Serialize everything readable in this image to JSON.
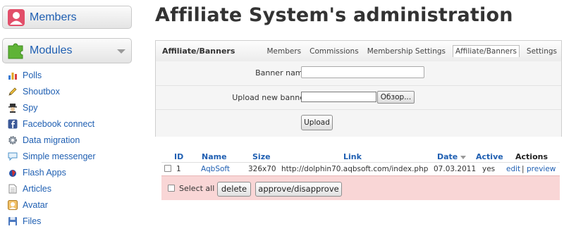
{
  "sidebar": {
    "members": {
      "label": "Members",
      "icon": "members-icon"
    },
    "modules": {
      "label": "Modules",
      "icon": "puzzle-icon"
    },
    "items": [
      {
        "label": "Polls",
        "icon": "bar-chart-icon"
      },
      {
        "label": "Shoutbox",
        "icon": "pencil-icon"
      },
      {
        "label": "Spy",
        "icon": "spy-icon"
      },
      {
        "label": "Facebook connect",
        "icon": "facebook-icon"
      },
      {
        "label": "Data migration",
        "icon": "migration-gear-icon"
      },
      {
        "label": "Simple messenger",
        "icon": "speech-bubble-icon"
      },
      {
        "label": "Flash Apps",
        "icon": "flash-icon"
      },
      {
        "label": "Articles",
        "icon": "document-icon"
      },
      {
        "label": "Avatar",
        "icon": "avatar-icon"
      },
      {
        "label": "Files",
        "icon": "floppy-icon"
      }
    ]
  },
  "page": {
    "title": "Affiliate System's administration"
  },
  "panel": {
    "title": "Affiliate/Banners",
    "tabs": [
      {
        "label": "Members",
        "active": false
      },
      {
        "label": "Commissions",
        "active": false
      },
      {
        "label": "Membership Settings",
        "active": false
      },
      {
        "label": "Affiliate/Banners",
        "active": true
      },
      {
        "label": "Settings",
        "active": false
      }
    ],
    "banner_name_label": "Banner name:",
    "banner_name_value": "",
    "upload_label": "Upload new banner:",
    "browse_label": "Обзор...",
    "upload_button": "Upload"
  },
  "table": {
    "headers": {
      "id": "ID",
      "name": "Name",
      "size": "Size",
      "link": "Link",
      "date": "Date",
      "active": "Active",
      "actions": "Actions"
    },
    "rows": [
      {
        "id": "1",
        "name": "AqbSoft",
        "size": "326x70",
        "link": "http://dolphin70.aqbsoft.com/index.php",
        "date": "07.03.2011",
        "active": "yes",
        "edit": "edit",
        "separator": "|",
        "preview": "preview"
      }
    ],
    "select_all_label": "Select all",
    "delete_button": "delete",
    "approve_button": "approve/disapprove"
  },
  "colors": {
    "link_blue": "#1f5fb2",
    "action_bar_pink": "#f9d6d6"
  }
}
